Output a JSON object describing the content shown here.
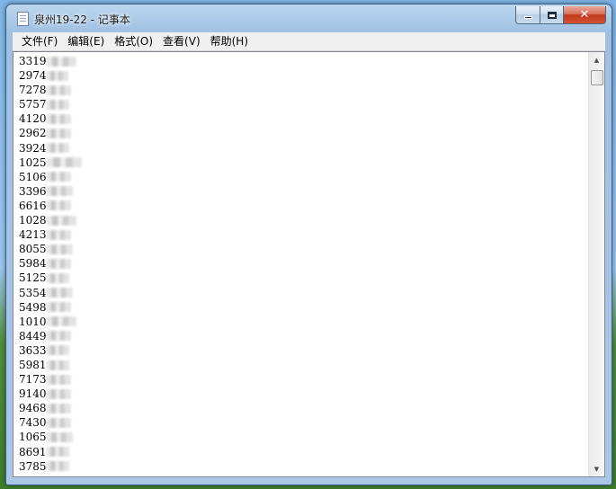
{
  "window": {
    "title": "泉州19-22 - 记事本",
    "caption": {
      "minimize": "minimize-icon",
      "maximize": "maximize-icon",
      "close_label": "✕"
    }
  },
  "menu": [
    {
      "label": "文件(F)"
    },
    {
      "label": "编辑(E)"
    },
    {
      "label": "格式(O)"
    },
    {
      "label": "查看(V)"
    },
    {
      "label": "帮助(H)"
    }
  ],
  "editor": {
    "lines": [
      "3319",
      "2974",
      "7278",
      "5757",
      "4120",
      "2962",
      "3924",
      "1025",
      "5106",
      "3396",
      "6616",
      "1028",
      "4213",
      "8055",
      "5984",
      "5125",
      "5354",
      "5498",
      "1010",
      "8449",
      "3633",
      "5981",
      "7173",
      "9140",
      "9468",
      "7430",
      "1065",
      "8691",
      "3785"
    ],
    "redaction": "blurred-digits"
  },
  "scrollbar": {
    "up_arrow": "▲",
    "down_arrow": "▼"
  },
  "colors": {
    "titlebar": "#a9c8e8",
    "close": "#c0391b",
    "menubar": "#f0f0f0"
  }
}
